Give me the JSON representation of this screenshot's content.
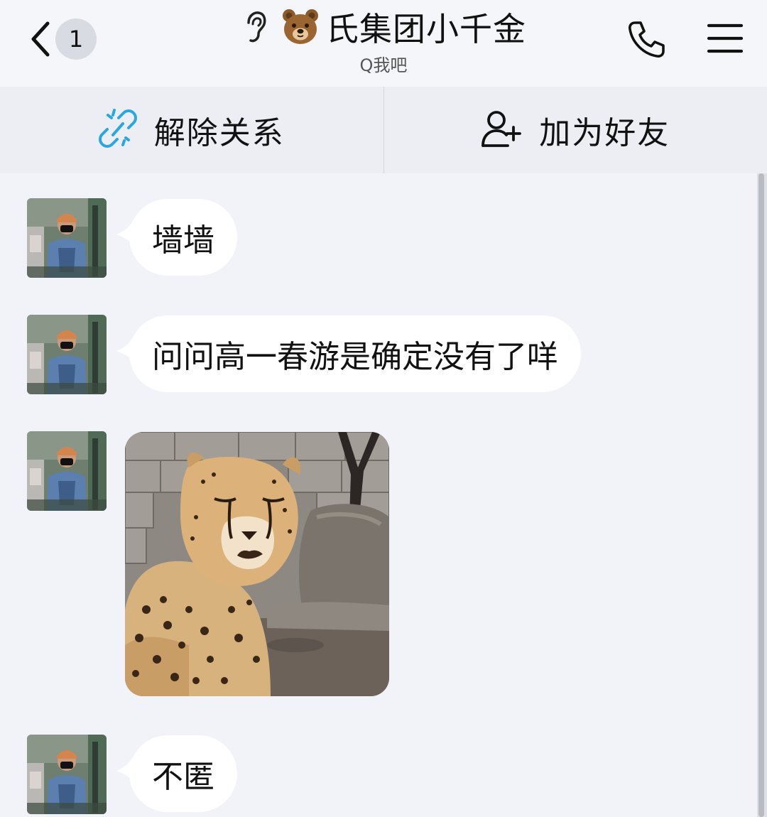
{
  "header": {
    "back_badge": "1",
    "title": "氏集团小千金",
    "subtitle": "Q我吧",
    "icons": {
      "back": "chevron-left-icon",
      "listen": "ear-icon",
      "emoji": "bear-face-emoji",
      "call": "phone-icon",
      "menu": "menu-icon"
    }
  },
  "actions": {
    "unlink_label": "解除关系",
    "add_friend_label": "加为好友",
    "unlink_icon_color": "#2aa7e0"
  },
  "messages": [
    {
      "type": "text",
      "text": "墙墙"
    },
    {
      "type": "text",
      "text": "问问高一春游是确定没有了咩"
    },
    {
      "type": "image",
      "subject": "cheetah"
    },
    {
      "type": "text",
      "text": "不匿"
    }
  ],
  "colors": {
    "background": "#f2f3f8",
    "bubble": "#ffffff",
    "action_bar": "#eceef3"
  }
}
